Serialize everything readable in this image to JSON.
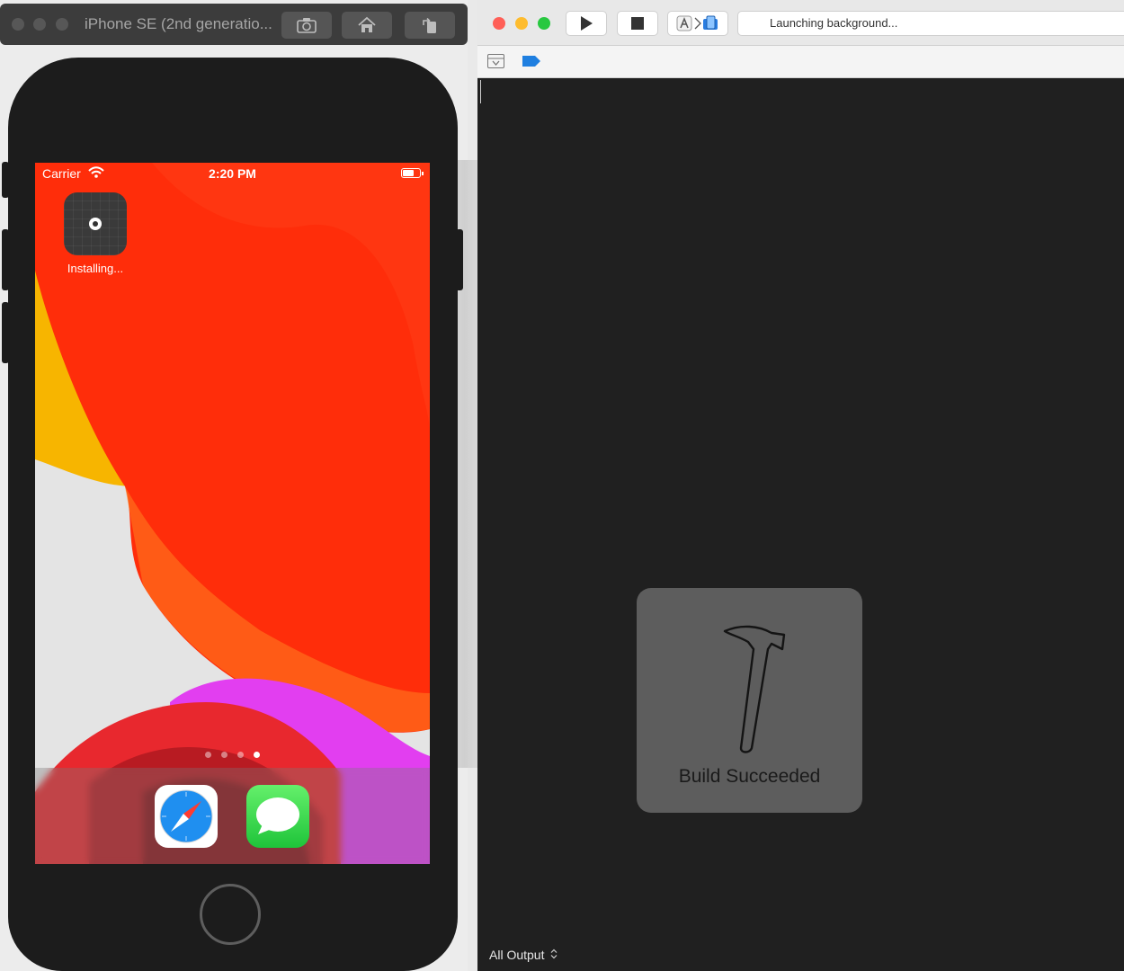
{
  "simulator": {
    "title": "iPhone SE (2nd generatio...",
    "buttons": [
      "screenshot-icon",
      "home-icon",
      "rotate-icon"
    ]
  },
  "phone": {
    "status": {
      "carrier": "Carrier",
      "time": "2:20 PM"
    },
    "installing_app": {
      "label": "Installing..."
    },
    "page_dots": {
      "count": 4,
      "active_index": 3
    },
    "dock_apps": [
      "safari-icon",
      "messages-icon"
    ]
  },
  "xcode": {
    "activity_status": "Launching background...",
    "hud_text": "Build Succeeded",
    "output_filter": "All Output",
    "colors": {
      "close": "#ff5f57",
      "minimize": "#febc2e",
      "zoom": "#28c840",
      "breakpoint": "#1f7fe0"
    }
  }
}
